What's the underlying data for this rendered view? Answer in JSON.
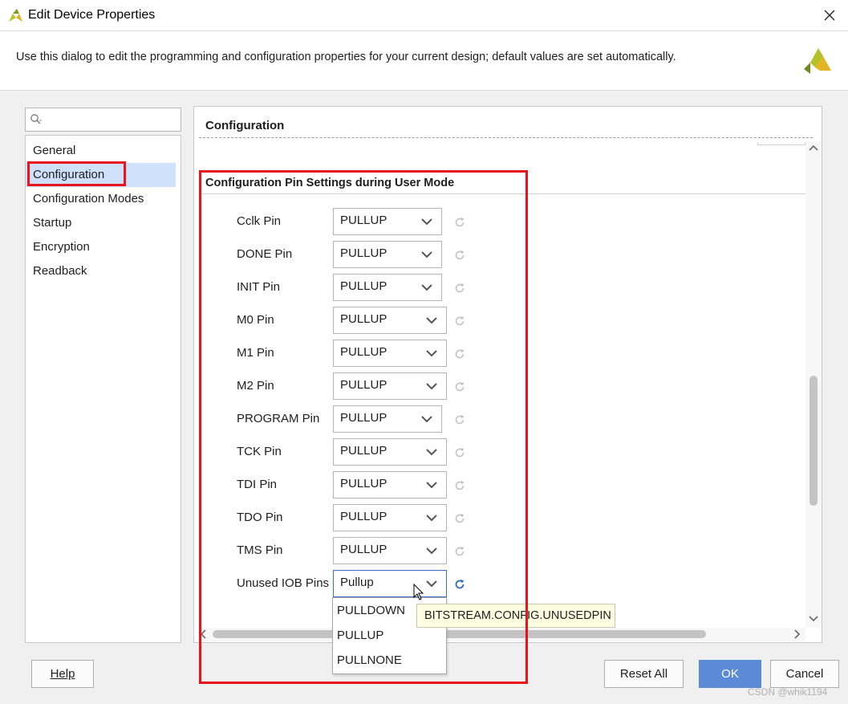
{
  "window": {
    "title": "Edit Device Properties",
    "close_label": "×"
  },
  "description": "Use this dialog to edit the programming and configuration properties for your current design; default values are set automatically.",
  "search": {
    "placeholder": "Q-",
    "value": ""
  },
  "sidebar": {
    "items": [
      {
        "label": "General"
      },
      {
        "label": "Configuration",
        "selected": true
      },
      {
        "label": "Configuration Modes"
      },
      {
        "label": "Startup"
      },
      {
        "label": "Encryption"
      },
      {
        "label": "Readback"
      }
    ]
  },
  "panel": {
    "header": "Configuration",
    "section_title": "Configuration Pin Settings during User Mode",
    "pins": [
      {
        "label": "Cclk Pin",
        "value": "PULLUP"
      },
      {
        "label": "DONE Pin",
        "value": "PULLUP"
      },
      {
        "label": "INIT Pin",
        "value": "PULLUP"
      },
      {
        "label": "M0 Pin",
        "value": "PULLUP"
      },
      {
        "label": "M1 Pin",
        "value": "PULLUP"
      },
      {
        "label": "M2 Pin",
        "value": "PULLUP"
      },
      {
        "label": "PROGRAM Pin",
        "value": "PULLUP"
      },
      {
        "label": "TCK Pin",
        "value": "PULLUP"
      },
      {
        "label": "TDI Pin",
        "value": "PULLUP"
      },
      {
        "label": "TDO Pin",
        "value": "PULLUP"
      },
      {
        "label": "TMS Pin",
        "value": "PULLUP"
      },
      {
        "label": "Unused IOB Pins",
        "value": "Pullup"
      }
    ],
    "dropdown_options": [
      "PULLDOWN",
      "PULLUP",
      "PULLNONE"
    ],
    "tooltip": "BITSTREAM.CONFIG.UNUSEDPIN"
  },
  "buttons": {
    "help": "Help",
    "reset_all": "Reset All",
    "ok": "OK",
    "cancel": "Cancel"
  },
  "watermark": "CSDN @whik1194",
  "colors": {
    "accent": "#5b8ad6",
    "selection": "#cfe0fb",
    "highlight": "#e8141a",
    "brand": "#8aa827"
  }
}
